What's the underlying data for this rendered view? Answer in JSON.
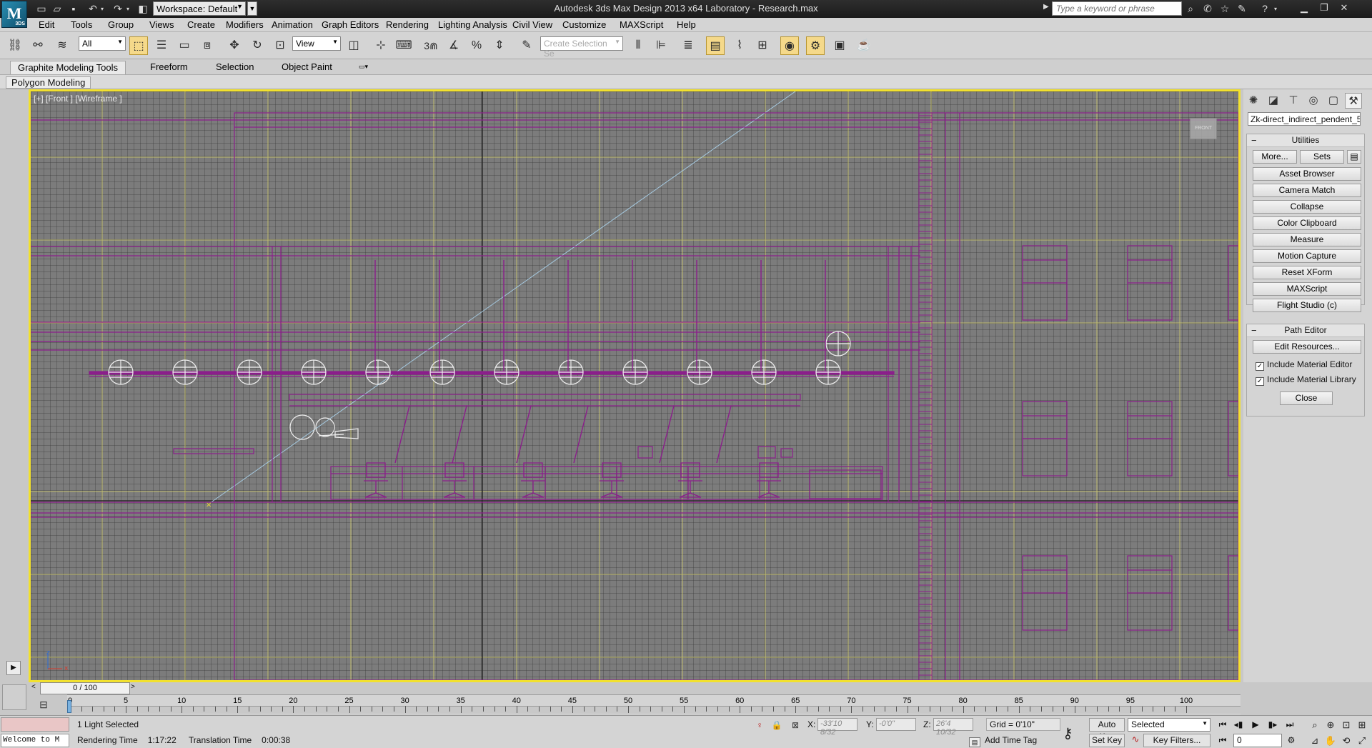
{
  "app": {
    "logo_text": "3DS",
    "window_title": "Autodesk 3ds Max Design 2013 x64      Laboratory - Research.max",
    "workspace": "Workspace: Default",
    "search_placeholder": "Type a keyword or phrase"
  },
  "menu": [
    "Edit",
    "Tools",
    "Group",
    "Views",
    "Create",
    "Modifiers",
    "Animation",
    "Graph Editors",
    "Rendering",
    "Lighting Analysis",
    "Civil View",
    "Customize",
    "MAXScript",
    "Help"
  ],
  "toolbar": {
    "selection_filter": "All",
    "reference_coord": "View",
    "named_selection_placeholder": "Create Selection Se",
    "snap_toggle_label": "3"
  },
  "ribbon": {
    "tabs": [
      "Graphite Modeling Tools",
      "Freeform",
      "Selection",
      "Object Paint"
    ],
    "panel_label": "Polygon Modeling"
  },
  "viewport": {
    "label": "[+] [Front ] [Wireframe ]",
    "view_cube_label": "FRONT",
    "axis_z": "z",
    "axis_x": "x"
  },
  "command_panel": {
    "object_name": "Zk-direct_indirect_pendent_5",
    "utilities_title": "Utilities",
    "more_button": "More...",
    "sets_button": "Sets",
    "utility_buttons": [
      "Asset Browser",
      "Camera Match",
      "Collapse",
      "Color Clipboard",
      "Measure",
      "Motion Capture",
      "Reset XForm",
      "MAXScript",
      "Flight Studio (c)"
    ],
    "path_editor": {
      "title": "Path Editor",
      "edit_resources": "Edit Resources...",
      "include_material_editor": "Include Material Editor",
      "include_material_editor_checked": true,
      "include_material_library": "Include Material Library",
      "include_material_library_checked": true,
      "close": "Close"
    }
  },
  "timeline": {
    "frame_display": "0 / 100",
    "ticks": [
      "0",
      "5",
      "10",
      "15",
      "20",
      "25",
      "30",
      "35",
      "40",
      "45",
      "50",
      "55",
      "60",
      "65",
      "70",
      "75",
      "80",
      "85",
      "90",
      "95",
      "100"
    ],
    "start": 0,
    "end": 100
  },
  "status": {
    "welcome": "Welcome to M",
    "selection": "1 Light Selected",
    "rendering_time_label": "Rendering Time",
    "rendering_time": "1:17:22",
    "translation_time_label": "Translation Time",
    "translation_time": "0:00:38",
    "x_label": "X:",
    "x_value": "-33'10 8/32",
    "y_label": "Y:",
    "y_value": "-0'0\"",
    "z_label": "Z:",
    "z_value": "26'4 10/32",
    "grid": "Grid = 0'10\"",
    "add_time_tag": "Add Time Tag",
    "auto_key": "Auto Key",
    "set_key": "Set Key",
    "key_mode": "Selected",
    "key_filters": "Key Filters...",
    "current_frame": "0"
  },
  "colors": {
    "viewport_border": "#f2e12e",
    "wire_purple": "#8b1e8b",
    "grid_major": "#d9d36a"
  }
}
